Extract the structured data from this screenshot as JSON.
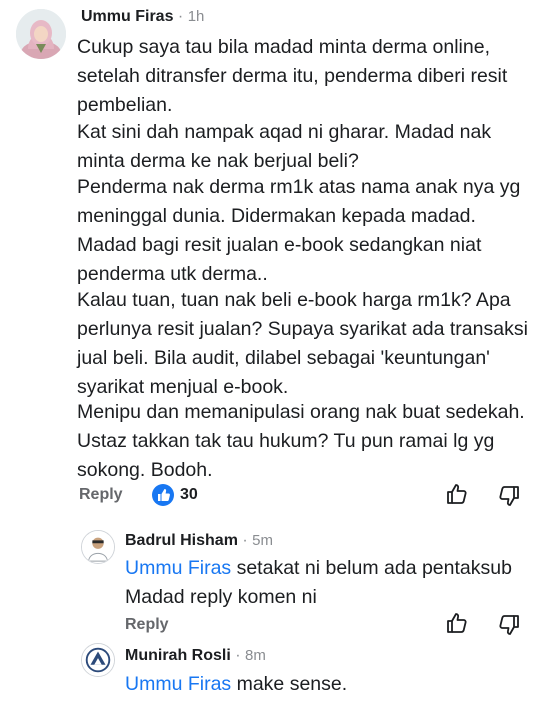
{
  "colors": {
    "link": "#1877f2",
    "muted": "#65676b",
    "like_badge": "#1877f2"
  },
  "main_comment": {
    "author": "Ummu Firas",
    "time": "1h",
    "paragraphs": [
      "Cukup saya tau bila madad minta derma online, setelah ditransfer derma itu, penderma diberi resit pembelian.",
      "Kat sini dah nampak aqad ni gharar. Madad nak minta derma ke nak berjual beli?",
      "Penderma nak derma rm1k atas nama anak nya yg meninggal dunia. Didermakan kepada madad. Madad bagi resit jualan e-book sedangkan niat penderma utk derma..",
      "Kalau tuan, tuan nak beli e-book harga rm1k? Apa perlunya resit jualan? Supaya syarikat ada transaksi jual beli. Bila audit, dilabel sebagai 'keuntungan' syarikat menjual e-book.",
      "Menipu dan memanipulasi orang nak buat sedekah. Ustaz takkan tak tau hukum? Tu pun ramai lg yg sokong. Bodoh."
    ],
    "reply_label": "Reply",
    "like_count": "30"
  },
  "replies": [
    {
      "author": "Badrul Hisham",
      "time": "5m",
      "mention": "Ummu Firas",
      "text_line1": " setakat ni belum ada pentaksub",
      "text_line2": "Madad reply komen ni",
      "reply_label": "Reply"
    },
    {
      "author": "Munirah Rosli",
      "time": "8m",
      "mention": "Ummu Firas",
      "text_line1": " make sense."
    }
  ],
  "separator": "·",
  "icons": {
    "like_badge": "thumbs-up-icon",
    "like_button": "thumbs-up-outline-icon",
    "dislike_button": "thumbs-down-outline-icon"
  }
}
